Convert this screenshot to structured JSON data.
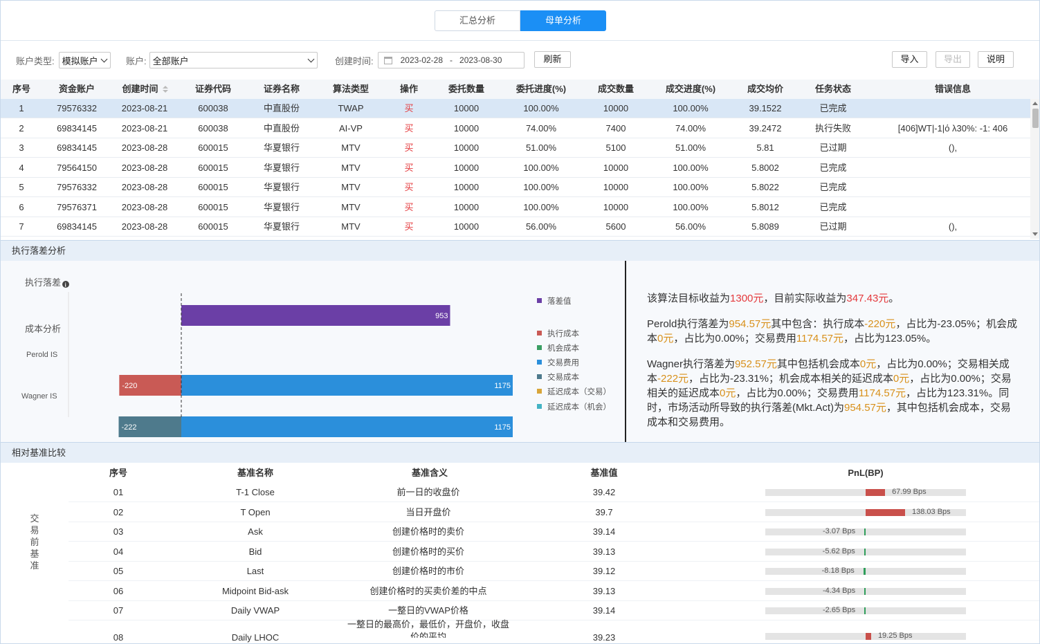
{
  "tabs": [
    {
      "label": "汇总分析",
      "active": false
    },
    {
      "label": "母单分析",
      "active": true
    }
  ],
  "filters": {
    "account_type_label": "账户类型:",
    "account_type_value": "模拟账户",
    "account_label": "账户:",
    "account_value": "全部账户",
    "created_label": "创建时间:",
    "date_start": "2023-02-28",
    "date_sep": "-",
    "date_end": "2023-08-30",
    "refresh": "刷新"
  },
  "actions": {
    "import": "导入",
    "export": "导出",
    "help": "说明"
  },
  "orders": {
    "columns": [
      "序号",
      "资金账户",
      "创建时间",
      "证券代码",
      "证券名称",
      "算法类型",
      "操作",
      "委托数量",
      "委托进度(%)",
      "成交数量",
      "成交进度(%)",
      "成交均价",
      "任务状态",
      "错误信息"
    ],
    "rows": [
      [
        "1",
        "79576332",
        "2023-08-21",
        "600038",
        "中直股份",
        "TWAP",
        "买",
        "10000",
        "100.00%",
        "10000",
        "100.00%",
        "39.1522",
        "已完成",
        ""
      ],
      [
        "2",
        "69834145",
        "2023-08-21",
        "600038",
        "中直股份",
        "AI-VP",
        "买",
        "10000",
        "74.00%",
        "7400",
        "74.00%",
        "39.2472",
        "执行失败",
        "[406]WT|-1|ό λ30%: -1: 406"
      ],
      [
        "3",
        "69834145",
        "2023-08-28",
        "600015",
        "华夏银行",
        "MTV",
        "买",
        "10000",
        "51.00%",
        "5100",
        "51.00%",
        "5.81",
        "已过期",
        "(),"
      ],
      [
        "4",
        "79564150",
        "2023-08-28",
        "600015",
        "华夏银行",
        "MTV",
        "买",
        "10000",
        "100.00%",
        "10000",
        "100.00%",
        "5.8002",
        "已完成",
        ""
      ],
      [
        "5",
        "79576332",
        "2023-08-28",
        "600015",
        "华夏银行",
        "MTV",
        "买",
        "10000",
        "100.00%",
        "10000",
        "100.00%",
        "5.8022",
        "已完成",
        ""
      ],
      [
        "6",
        "79576371",
        "2023-08-28",
        "600015",
        "华夏银行",
        "MTV",
        "买",
        "10000",
        "100.00%",
        "10000",
        "100.00%",
        "5.8012",
        "已完成",
        ""
      ],
      [
        "7",
        "69834145",
        "2023-08-28",
        "600015",
        "华夏银行",
        "MTV",
        "买",
        "10000",
        "56.00%",
        "5600",
        "56.00%",
        "5.8089",
        "已过期",
        "(),"
      ]
    ]
  },
  "slippage": {
    "section_title": "执行落差分析",
    "chart_data": {
      "type": "bar",
      "orientation": "horizontal",
      "categories": [
        "执行落差",
        "成本分析",
        "Perold IS",
        "Wagner IS"
      ],
      "series": [
        {
          "name": "落差值",
          "color": "#6b3fa6",
          "values": [
            953,
            null,
            null,
            null
          ]
        },
        {
          "name": "执行成本",
          "color": "#c95a55",
          "values": [
            null,
            null,
            -220,
            null
          ]
        },
        {
          "name": "机会成本",
          "color": "#3a9e63",
          "values": [
            null,
            null,
            0,
            0
          ]
        },
        {
          "name": "交易费用",
          "color": "#2b8fdb",
          "values": [
            null,
            null,
            1175,
            1175
          ]
        },
        {
          "name": "交易成本",
          "color": "#4e7a8c",
          "values": [
            null,
            null,
            null,
            -222
          ]
        },
        {
          "name": "延迟成本（交易）",
          "color": "#d8a53a",
          "values": [
            null,
            null,
            null,
            0
          ]
        },
        {
          "name": "延迟成本（机会）",
          "color": "#43b3c4",
          "values": [
            null,
            null,
            null,
            0
          ]
        }
      ],
      "legend_position": "right"
    },
    "summary": {
      "p1": [
        [
          "该算法目标收益为",
          ""
        ],
        [
          "1300元",
          "r"
        ],
        [
          "，目前实际收益为",
          ""
        ],
        [
          "347.43元",
          "r"
        ],
        [
          "。",
          ""
        ]
      ],
      "p2": [
        [
          "Perold执行落差为",
          ""
        ],
        [
          "954.57元",
          "o"
        ],
        [
          "其中包含：执行成本",
          ""
        ],
        [
          "-220元",
          "o"
        ],
        [
          "，占比为-23.05%；机会成本",
          ""
        ],
        [
          "0元",
          "o"
        ],
        [
          "，占比为0.00%；交易费用",
          ""
        ],
        [
          "1174.57元",
          "o"
        ],
        [
          "，占比为123.05%。",
          ""
        ]
      ],
      "p3": [
        [
          "Wagner执行落差为",
          ""
        ],
        [
          "952.57元",
          "o"
        ],
        [
          "其中包括机会成本",
          ""
        ],
        [
          "0元",
          "o"
        ],
        [
          "，占比为0.00%；交易相关成本",
          ""
        ],
        [
          "-222元",
          "o"
        ],
        [
          "，占比为-23.31%；机会成本相关的延迟成本",
          ""
        ],
        [
          "0元",
          "o"
        ],
        [
          "，占比为0.00%；交易相关的延迟成本",
          ""
        ],
        [
          "0元",
          "o"
        ],
        [
          "，占比为0.00%；交易费用",
          ""
        ],
        [
          "1174.57元",
          "o"
        ],
        [
          "，占比为123.31%。同时，市场活动所导致的执行落差(Mkt.Act)为",
          ""
        ],
        [
          "954.57元",
          "o"
        ],
        [
          "，其中包括机会成本，交易成本和交易费用。",
          ""
        ]
      ]
    }
  },
  "benchmark": {
    "section_title": "相对基准比较",
    "group_label": "交易前基准",
    "columns": [
      "序号",
      "基准名称",
      "基准含义",
      "基准值",
      "PnL(BP)"
    ],
    "rows": [
      {
        "no": "01",
        "name": "T-1 Close",
        "desc": "前一日的收盘价",
        "value": "39.42",
        "pnl": 67.99,
        "pnl_label": "67.99 Bps"
      },
      {
        "no": "02",
        "name": "T Open",
        "desc": "当日开盘价",
        "value": "39.7",
        "pnl": 138.03,
        "pnl_label": "138.03 Bps"
      },
      {
        "no": "03",
        "name": "Ask",
        "desc": "创建价格时的卖价",
        "value": "39.14",
        "pnl": -3.07,
        "pnl_label": "-3.07 Bps"
      },
      {
        "no": "04",
        "name": "Bid",
        "desc": "创建价格时的买价",
        "value": "39.13",
        "pnl": -5.62,
        "pnl_label": "-5.62 Bps"
      },
      {
        "no": "05",
        "name": "Last",
        "desc": "创建价格时的市价",
        "value": "39.12",
        "pnl": -8.18,
        "pnl_label": "-8.18 Bps"
      },
      {
        "no": "06",
        "name": "Midpoint Bid-ask",
        "desc": "创建价格时的买卖价差的中点",
        "value": "39.13",
        "pnl": -4.34,
        "pnl_label": "-4.34 Bps"
      },
      {
        "no": "07",
        "name": "Daily VWAP",
        "desc": "一整日的VWAP价格",
        "value": "39.14",
        "pnl": -2.65,
        "pnl_label": "-2.65 Bps"
      },
      {
        "no": "08",
        "name": "Daily LHOC",
        "desc": "一整日的最高价，最低价，开盘价，收盘价的平均",
        "value": "39.23",
        "pnl": 19.25,
        "pnl_label": "19.25 Bps"
      }
    ],
    "colors": {
      "pos": "#c9504b",
      "neg": "#2f9e5a"
    }
  }
}
